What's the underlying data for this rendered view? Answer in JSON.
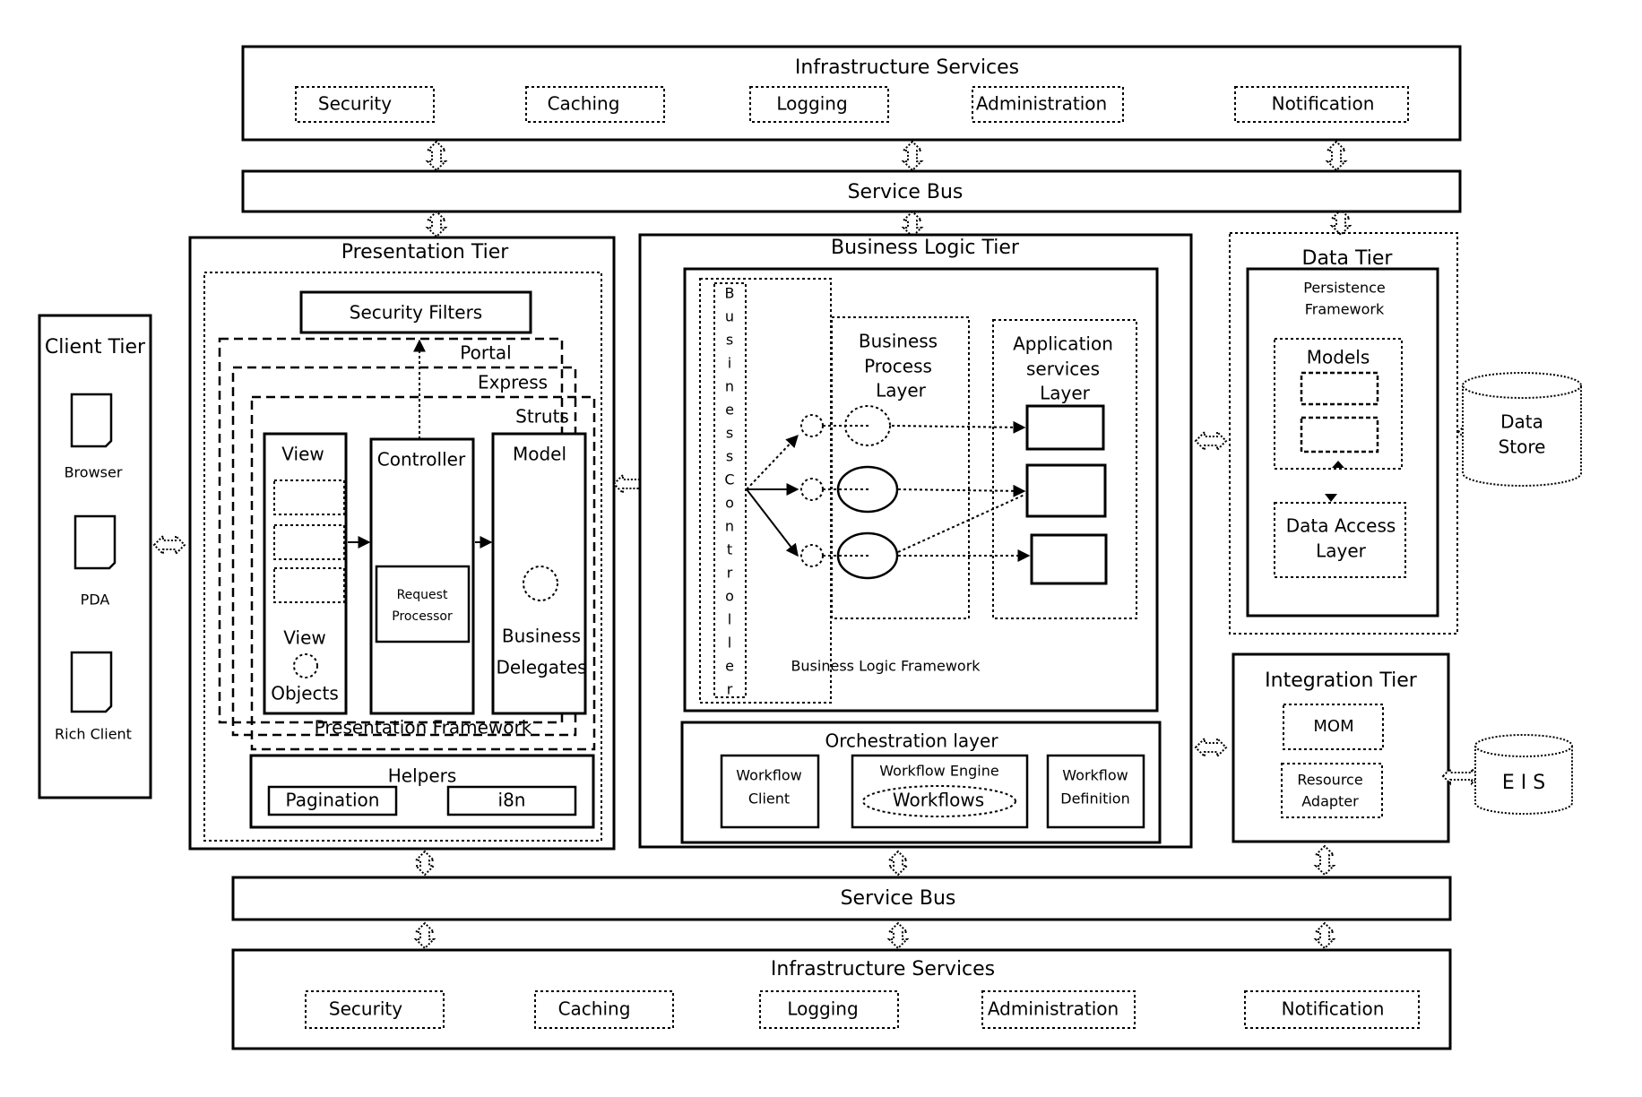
{
  "infrastructure_top": {
    "title": "Infrastructure Services",
    "services": [
      "Security",
      "Caching",
      "Logging",
      "Administration",
      "Notification"
    ]
  },
  "service_bus_top": {
    "label": "Service Bus"
  },
  "client_tier": {
    "title": "Client Tier",
    "clients": [
      "Browser",
      "PDA",
      "Rich Client"
    ]
  },
  "presentation_tier": {
    "title": "Presentation Tier",
    "security_filters": "Security Filters",
    "frameworks": [
      "Portal",
      "Express",
      "Struts"
    ],
    "view": {
      "title": "View",
      "objects_label_1": "View",
      "objects_label_2": "Objects"
    },
    "controller": {
      "title": "Controller",
      "request_processor_1": "Request",
      "request_processor_2": "Processor"
    },
    "model": {
      "title": "Model",
      "delegates_1": "Business",
      "delegates_2": "Delegates"
    },
    "framework_label": "Presentation Framework",
    "helpers": {
      "title": "Helpers",
      "items": [
        "Pagination",
        "i8n"
      ]
    }
  },
  "business_logic_tier": {
    "title": "Business Logic Tier",
    "business_controller": "Business Controller",
    "business_process_layer": [
      "Business",
      "Process",
      "Layer"
    ],
    "application_services_layer": [
      "Application",
      "services",
      "Layer"
    ],
    "framework_label": "Business Logic Framework",
    "orchestration": {
      "title": "Orchestration layer",
      "workflow_client": [
        "Workflow",
        "Client"
      ],
      "workflow_engine": "Workflow Engine",
      "workflows": "Workflows",
      "workflow_definition": [
        "Workflow",
        "Definition"
      ]
    }
  },
  "data_tier": {
    "title": "Data Tier",
    "persistence_framework": [
      "Persistence",
      "Framework"
    ],
    "models": "Models",
    "data_access_layer": [
      "Data Access",
      "Layer"
    ],
    "data_store": [
      "Data",
      "Store"
    ]
  },
  "integration_tier": {
    "title": "Integration Tier",
    "mom": "MOM",
    "resource_adapter": [
      "Resource",
      "Adapter"
    ],
    "eis": "E I S"
  },
  "service_bus_bottom": {
    "label": "Service Bus"
  },
  "infrastructure_bottom": {
    "title": "Infrastructure Services",
    "services": [
      "Security",
      "Caching",
      "Logging",
      "Administration",
      "Notification"
    ]
  }
}
